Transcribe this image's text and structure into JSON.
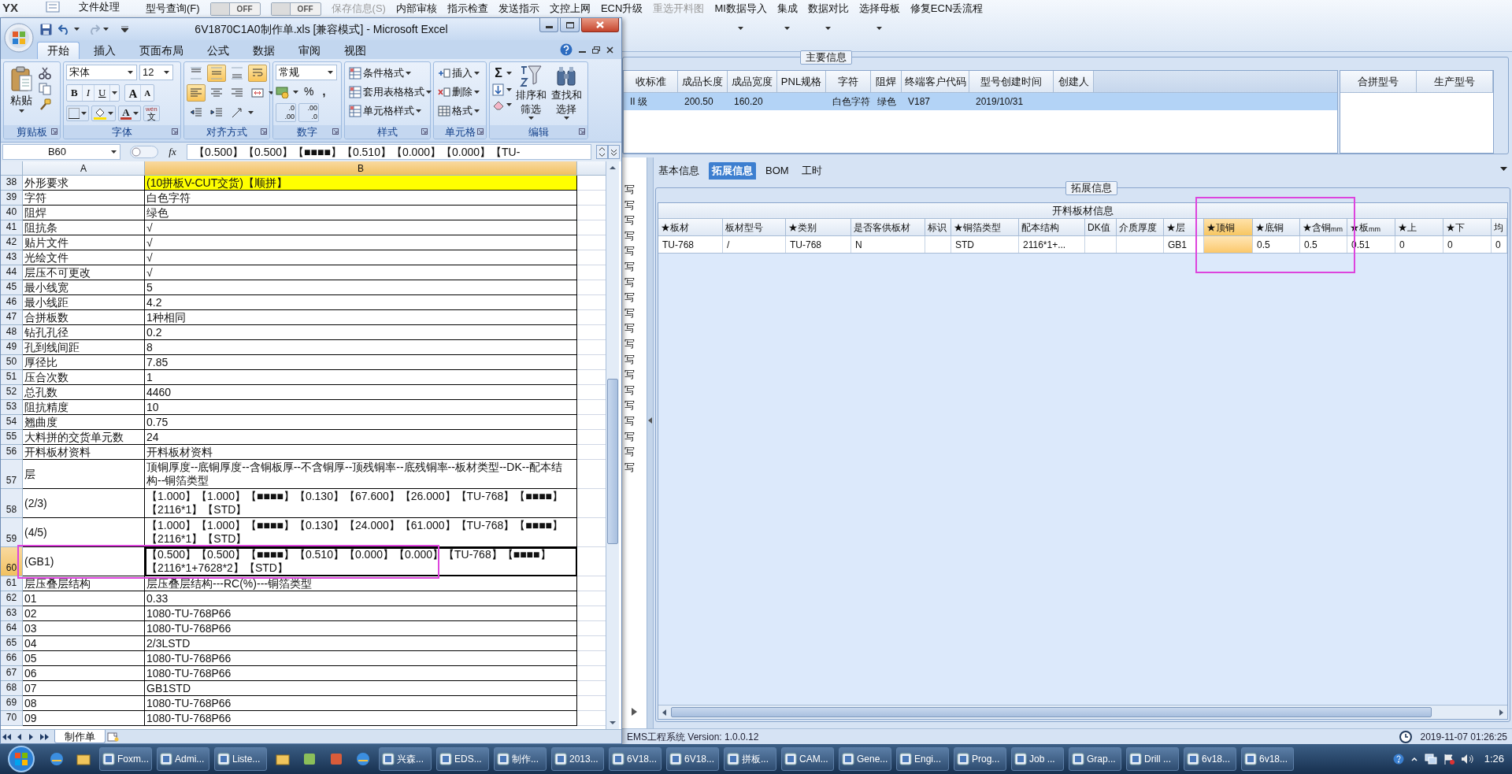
{
  "app": {
    "logo": "YX",
    "file_menu": "文件处理",
    "menu": [
      {
        "kind": "menu",
        "label": "型号查询(F)",
        "disabled": false,
        "dropdown": false
      },
      {
        "kind": "toggle",
        "label": "OFF",
        "on": false
      },
      {
        "kind": "toggle",
        "label": "OFF",
        "on": false
      },
      {
        "kind": "menu",
        "label": "保存信息(S)",
        "disabled": true,
        "dropdown": false
      },
      {
        "kind": "menu",
        "label": "内部审核",
        "disabled": false,
        "dropdown": false
      },
      {
        "kind": "menu",
        "label": "指示检查",
        "disabled": false,
        "dropdown": false
      },
      {
        "kind": "menu",
        "label": "发送指示",
        "disabled": false,
        "dropdown": false
      },
      {
        "kind": "menu",
        "label": "文控上网",
        "disabled": false,
        "dropdown": false
      },
      {
        "kind": "menu",
        "label": "ECN升级",
        "disabled": false,
        "dropdown": false
      },
      {
        "kind": "menu",
        "label": "重选开料图",
        "disabled": true,
        "dropdown": false
      },
      {
        "kind": "menu",
        "label": "MI数据导入",
        "disabled": false,
        "dropdown": true
      },
      {
        "kind": "menu",
        "label": "集成",
        "disabled": false,
        "dropdown": true
      },
      {
        "kind": "menu",
        "label": "数据对比",
        "disabled": false,
        "dropdown": true
      },
      {
        "kind": "menu",
        "label": "选择母板",
        "disabled": false,
        "dropdown": true
      },
      {
        "kind": "menu",
        "label": "修复ECN丢流程",
        "disabled": false,
        "dropdown": false
      }
    ],
    "main_info": {
      "title": "主要信息",
      "columns": [
        "收标准",
        "成品长度",
        "成品宽度",
        "PNL规格",
        "字符",
        "阻焊",
        "终端客户代码",
        "型号创建时间",
        "创建人"
      ],
      "rows": [
        {
          "selected": true,
          "cells": [
            "II 级",
            "200.50",
            "160.20",
            null,
            "白色字符",
            "绿色",
            "V187",
            "2019/10/31",
            null
          ]
        }
      ],
      "side_columns": [
        "合拼型号",
        "生产型号"
      ]
    },
    "side_list": [
      "写",
      "写",
      "写",
      "写",
      "写",
      "写",
      "写",
      "写",
      "写",
      "写",
      "写",
      "写",
      "写",
      "写",
      "写",
      "写",
      "写",
      "写",
      "写"
    ],
    "tabs": [
      {
        "label": "基本信息",
        "selected": false
      },
      {
        "label": "拓展信息",
        "selected": true
      },
      {
        "label": "BOM",
        "selected": false
      },
      {
        "label": "工时",
        "selected": false
      }
    ],
    "ext_info": {
      "title": "拓展信息",
      "table_title": "开料板材信息",
      "columns": [
        {
          "label": "★板材",
          "selected": false
        },
        {
          "label": "板材型号",
          "selected": false
        },
        {
          "label": "★类别",
          "selected": false
        },
        {
          "label": "是否客供板材",
          "selected": false
        },
        {
          "label": "标识",
          "selected": false
        },
        {
          "label": "★铜箔类型",
          "selected": false
        },
        {
          "label": "配本结构",
          "selected": false
        },
        {
          "label": "DK值",
          "selected": false
        },
        {
          "label": "介质厚度",
          "selected": false
        },
        {
          "label": "★层",
          "selected": false
        },
        {
          "label": "★顶铜",
          "selected": true
        },
        {
          "label": "★底铜",
          "selected": false
        },
        {
          "label": "★含铜$_{mm}$",
          "selected": false
        },
        {
          "label": "★板$_{mm}$",
          "selected": false
        },
        {
          "label": "★上",
          "selected": false
        },
        {
          "label": "★下",
          "selected": false
        },
        {
          "label": "均",
          "selected": false
        }
      ],
      "rows": [
        {
          "cells": [
            "TU-768",
            "/",
            "TU-768",
            "N",
            null,
            "STD",
            "2116*1+...",
            null,
            null,
            "GB1",
            null,
            "0.5",
            "0.5",
            "0.51",
            "0",
            "0",
            "0"
          ]
        }
      ]
    },
    "status_bar": {
      "text": "EMS工程系统 Version: 1.0.0.12",
      "time": "2019-11-07 01:26:25"
    }
  },
  "excel": {
    "title": "6V1870C1A0制作单.xls  [兼容模式] - Microsoft Excel",
    "ribbon_tabs": [
      {
        "label": "开始",
        "selected": true
      },
      {
        "label": "插入",
        "selected": false
      },
      {
        "label": "页面布局",
        "selected": false
      },
      {
        "label": "公式",
        "selected": false
      },
      {
        "label": "数据",
        "selected": false
      },
      {
        "label": "审阅",
        "selected": false
      },
      {
        "label": "视图",
        "selected": false
      }
    ],
    "clipboard": {
      "title": "剪贴板",
      "paste": "粘贴"
    },
    "font": {
      "title": "字体",
      "name": "宋体",
      "size": "12",
      "styles": [
        {
          "label": "B",
          "kind": "bold"
        },
        {
          "label": "I",
          "kind": "italic"
        },
        {
          "label": "U",
          "kind": "underline"
        }
      ],
      "grow": "A",
      "shrink": "A",
      "font_color_label": "A",
      "phonetic_top": "wén",
      "phonetic": "文"
    },
    "alignment": {
      "title": "对齐方式",
      "rows": [
        [
          {
            "kind": "top",
            "on": false
          },
          {
            "kind": "middle",
            "on": true
          },
          {
            "kind": "bottom",
            "on": false
          },
          {
            "kind": "wrap",
            "on": true
          }
        ],
        [
          {
            "kind": "left",
            "on": true
          },
          {
            "kind": "center",
            "on": false
          },
          {
            "kind": "right",
            "on": false
          },
          {
            "kind": "merge",
            "on": false
          }
        ],
        [
          {
            "kind": "outdent",
            "on": false
          },
          {
            "kind": "indent",
            "on": false
          },
          {
            "kind": "orientation",
            "on": false
          }
        ]
      ]
    },
    "number": {
      "title": "数字",
      "format": "常规",
      "percent": "%",
      "comma": ",",
      "decimals": [
        {
          "top": ".0",
          "bottom": ".00"
        },
        {
          "top": ".00",
          "bottom": ".0"
        }
      ]
    },
    "styles": {
      "title": "样式",
      "items": [
        "条件格式",
        "套用表格格式",
        "单元格样式"
      ]
    },
    "cells": {
      "title": "单元格",
      "items": [
        "插入",
        "删除",
        "格式"
      ]
    },
    "editing": {
      "title": "编辑",
      "sum": "Σ",
      "sort": "排序和筛选",
      "find": "查找和选择"
    },
    "name_box": "B60",
    "fx": "fx",
    "formula": "【0.500】【0.500】【■■■■】【0.510】【0.000】【0.000】【TU-",
    "columns": [
      {
        "label": "A",
        "selected": false
      },
      {
        "label": "B",
        "selected": true
      }
    ],
    "rows": [
      {
        "num": "38",
        "a": "外形要求",
        "b": "(10拼板V-CUT交货)【顺拼】",
        "highlighted": true,
        "selected": false
      },
      {
        "num": "39",
        "a": "字符",
        "b": "白色字符",
        "highlighted": false,
        "selected": false
      },
      {
        "num": "40",
        "a": "阻焊",
        "b": "绿色",
        "highlighted": false,
        "selected": false
      },
      {
        "num": "41",
        "a": "阻抗条",
        "b": "√",
        "highlighted": false,
        "selected": false
      },
      {
        "num": "42",
        "a": "贴片文件",
        "b": "√",
        "highlighted": false,
        "selected": false
      },
      {
        "num": "43",
        "a": "光绘文件",
        "b": "√",
        "highlighted": false,
        "selected": false
      },
      {
        "num": "44",
        "a": "层压不可更改",
        "b": "√",
        "highlighted": false,
        "selected": false
      },
      {
        "num": "45",
        "a": "最小线宽",
        "b": "5",
        "highlighted": false,
        "selected": false
      },
      {
        "num": "46",
        "a": "最小线距",
        "b": "4.2",
        "highlighted": false,
        "selected": false
      },
      {
        "num": "47",
        "a": "合拼板数",
        "b": "1种相同",
        "highlighted": false,
        "selected": false
      },
      {
        "num": "48",
        "a": "钻孔孔径",
        "b": "0.2",
        "highlighted": false,
        "selected": false
      },
      {
        "num": "49",
        "a": "孔到线间距",
        "b": "8",
        "highlighted": false,
        "selected": false
      },
      {
        "num": "50",
        "a": "厚径比",
        "b": "7.85",
        "highlighted": false,
        "selected": false
      },
      {
        "num": "51",
        "a": "压合次数",
        "b": "1",
        "highlighted": false,
        "selected": false
      },
      {
        "num": "52",
        "a": "总孔数",
        "b": "4460",
        "highlighted": false,
        "selected": false
      },
      {
        "num": "53",
        "a": "阻抗精度",
        "b": "10",
        "highlighted": false,
        "selected": false
      },
      {
        "num": "54",
        "a": "翘曲度",
        "b": "0.75",
        "highlighted": false,
        "selected": false
      },
      {
        "num": "55",
        "a": "大料拼的交货单元数",
        "b": "24",
        "highlighted": false,
        "selected": false
      },
      {
        "num": "56",
        "a": "开料板材资料",
        "b": "开料板材资料",
        "highlighted": false,
        "selected": false
      },
      {
        "num": "57",
        "a": "层",
        "b": "顶铜厚度--底铜厚度--含铜板厚--不含铜厚--顶残铜率--底残铜率--板材类型--DK--配本结构--铜箔类型",
        "highlighted": false,
        "selected": false
      },
      {
        "num": "58",
        "a": "(2/3)",
        "b": "【1.000】【1.000】【■■■■】【0.130】【67.600】【26.000】【TU-768】【■■■■】【2116*1】【STD】",
        "highlighted": false,
        "selected": false
      },
      {
        "num": "59",
        "a": "(4/5)",
        "b": "【1.000】【1.000】【■■■■】【0.130】【24.000】【61.000】【TU-768】【■■■■】【2116*1】【STD】",
        "highlighted": false,
        "selected": false
      },
      {
        "num": "60",
        "a": "(GB1)",
        "b": "【0.500】【0.500】【■■■■】【0.510】【0.000】【0.000】【TU-768】【■■■■】【2116*1+7628*2】【STD】",
        "highlighted": false,
        "selected": true
      },
      {
        "num": "61",
        "a": "层压叠层结构",
        "b": "层压叠层结构---RC(%)---铜箔类型",
        "highlighted": false,
        "selected": false
      },
      {
        "num": "62",
        "a": "01",
        "b": "0.33",
        "highlighted": false,
        "selected": false
      },
      {
        "num": "63",
        "a": "02",
        "b": "1080-TU-768P66",
        "highlighted": false,
        "selected": false
      },
      {
        "num": "64",
        "a": "03",
        "b": "1080-TU-768P66",
        "highlighted": false,
        "selected": false
      },
      {
        "num": "65",
        "a": "04",
        "b": "2/3LSTD",
        "highlighted": false,
        "selected": false
      },
      {
        "num": "66",
        "a": "05",
        "b": "1080-TU-768P66",
        "highlighted": false,
        "selected": false
      },
      {
        "num": "67",
        "a": "06",
        "b": "1080-TU-768P66",
        "highlighted": false,
        "selected": false
      },
      {
        "num": "68",
        "a": "07",
        "b": "GB1STD",
        "highlighted": false,
        "selected": false
      },
      {
        "num": "69",
        "a": "08",
        "b": "1080-TU-768P66",
        "highlighted": false,
        "selected": false
      },
      {
        "num": "70",
        "a": "09",
        "b": "1080-TU-768P66",
        "highlighted": false,
        "selected": false
      }
    ],
    "sheets": [
      {
        "label": "制作单",
        "selected": true
      }
    ]
  },
  "taskbar": {
    "items": [
      {
        "kind": "icon"
      },
      {
        "kind": "icon"
      },
      {
        "kind": "button",
        "label": "Foxm..."
      },
      {
        "kind": "button",
        "label": "Admi..."
      },
      {
        "kind": "button",
        "label": "Liste..."
      },
      {
        "kind": "icon"
      },
      {
        "kind": "icon"
      },
      {
        "kind": "icon"
      },
      {
        "kind": "icon"
      },
      {
        "kind": "button",
        "label": "兴森..."
      },
      {
        "kind": "button",
        "label": "EDS..."
      },
      {
        "kind": "button",
        "label": "制作..."
      },
      {
        "kind": "button",
        "label": "2013..."
      },
      {
        "kind": "button",
        "label": "6V18..."
      },
      {
        "kind": "button",
        "label": "6V18..."
      },
      {
        "kind": "button",
        "label": "拼板..."
      },
      {
        "kind": "button",
        "label": "CAM..."
      },
      {
        "kind": "button",
        "label": "Gene..."
      },
      {
        "kind": "button",
        "label": "Engi..."
      },
      {
        "kind": "button",
        "label": "Prog..."
      },
      {
        "kind": "button",
        "label": "Job ..."
      },
      {
        "kind": "button",
        "label": "Grap..."
      },
      {
        "kind": "button",
        "label": "Drill ..."
      },
      {
        "kind": "button",
        "label": "6v18..."
      },
      {
        "kind": "button",
        "label": "6v18..."
      }
    ],
    "clock": "1:26"
  }
}
